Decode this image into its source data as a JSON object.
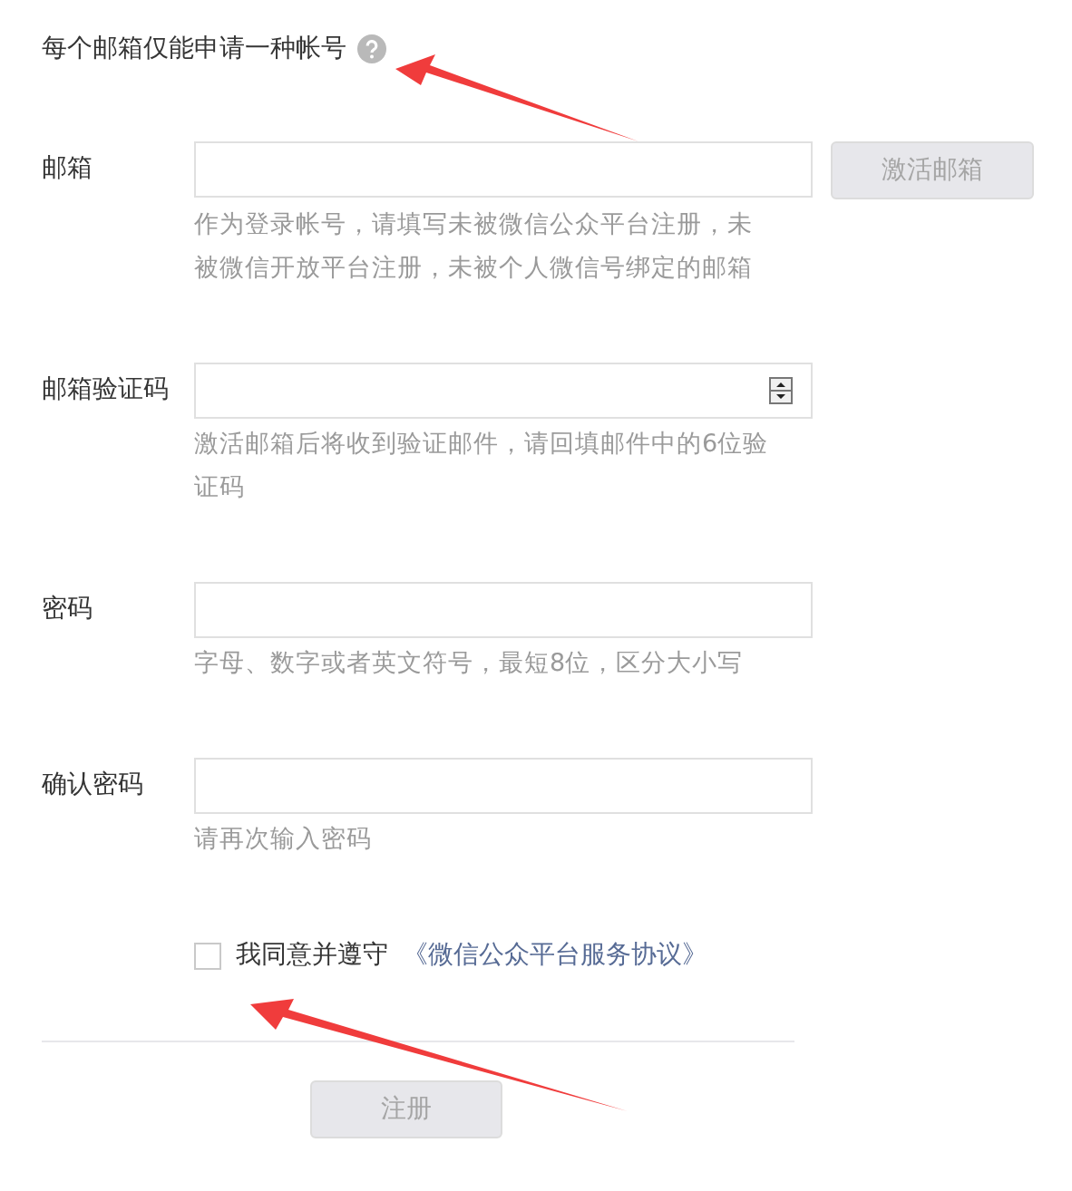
{
  "heading": {
    "text": "每个邮箱仅能申请一种帐号"
  },
  "fields": [
    {
      "label": "邮箱",
      "kind": "text",
      "hint": "作为登录帐号，请填写未被微信公众平台注册，未被微信开放平台注册，未被个人微信号绑定的邮箱",
      "button": {
        "label": "激活邮箱",
        "disabled": true
      }
    },
    {
      "label": "邮箱验证码",
      "kind": "number",
      "hint": "激活邮箱后将收到验证邮件，请回填邮件中的6位验证码"
    },
    {
      "label": "密码",
      "kind": "password",
      "hint": "字母、数字或者英文符号，最短8位，区分大小写"
    },
    {
      "label": "确认密码",
      "kind": "password",
      "hint": "请再次输入密码"
    }
  ],
  "agreement": {
    "checked": false,
    "text": "我同意并遵守",
    "link": "《微信公众平台服务协议》"
  },
  "submit": {
    "label": "注册",
    "disabled": true
  }
}
